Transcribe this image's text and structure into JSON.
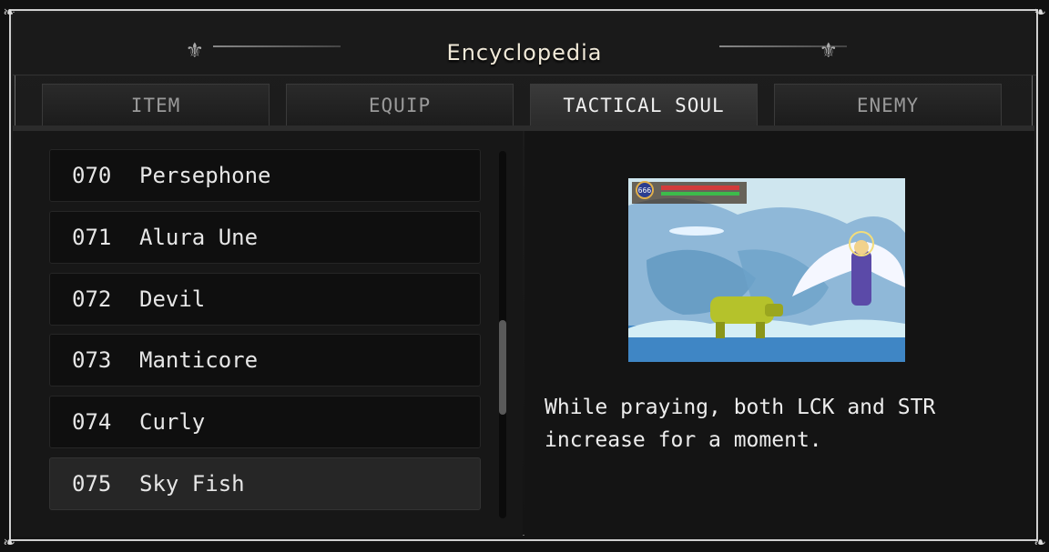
{
  "window": {
    "title": "Encyclopedia"
  },
  "tabs": [
    {
      "label": "ITEM",
      "active": false
    },
    {
      "label": "EQUIP",
      "active": false
    },
    {
      "label": "TACTICAL SOUL",
      "active": true
    },
    {
      "label": "ENEMY",
      "active": false
    }
  ],
  "list": {
    "items": [
      {
        "number": "070",
        "name": "Persephone"
      },
      {
        "number": "071",
        "name": "Alura Une"
      },
      {
        "number": "072",
        "name": "Devil"
      },
      {
        "number": "073",
        "name": "Manticore"
      },
      {
        "number": "074",
        "name": "Curly"
      },
      {
        "number": "075",
        "name": "Sky Fish"
      }
    ],
    "selected_index": 5
  },
  "detail": {
    "hud_value": "666",
    "description": "While praying, both LCK and STR\nincrease for a moment."
  },
  "colors": {
    "sky": "#8fb8d8",
    "cave": "#5f97c0",
    "beast": "#b5c22b",
    "hp_bar": "#d33b3b",
    "mp_bar": "#3dbb4b"
  }
}
